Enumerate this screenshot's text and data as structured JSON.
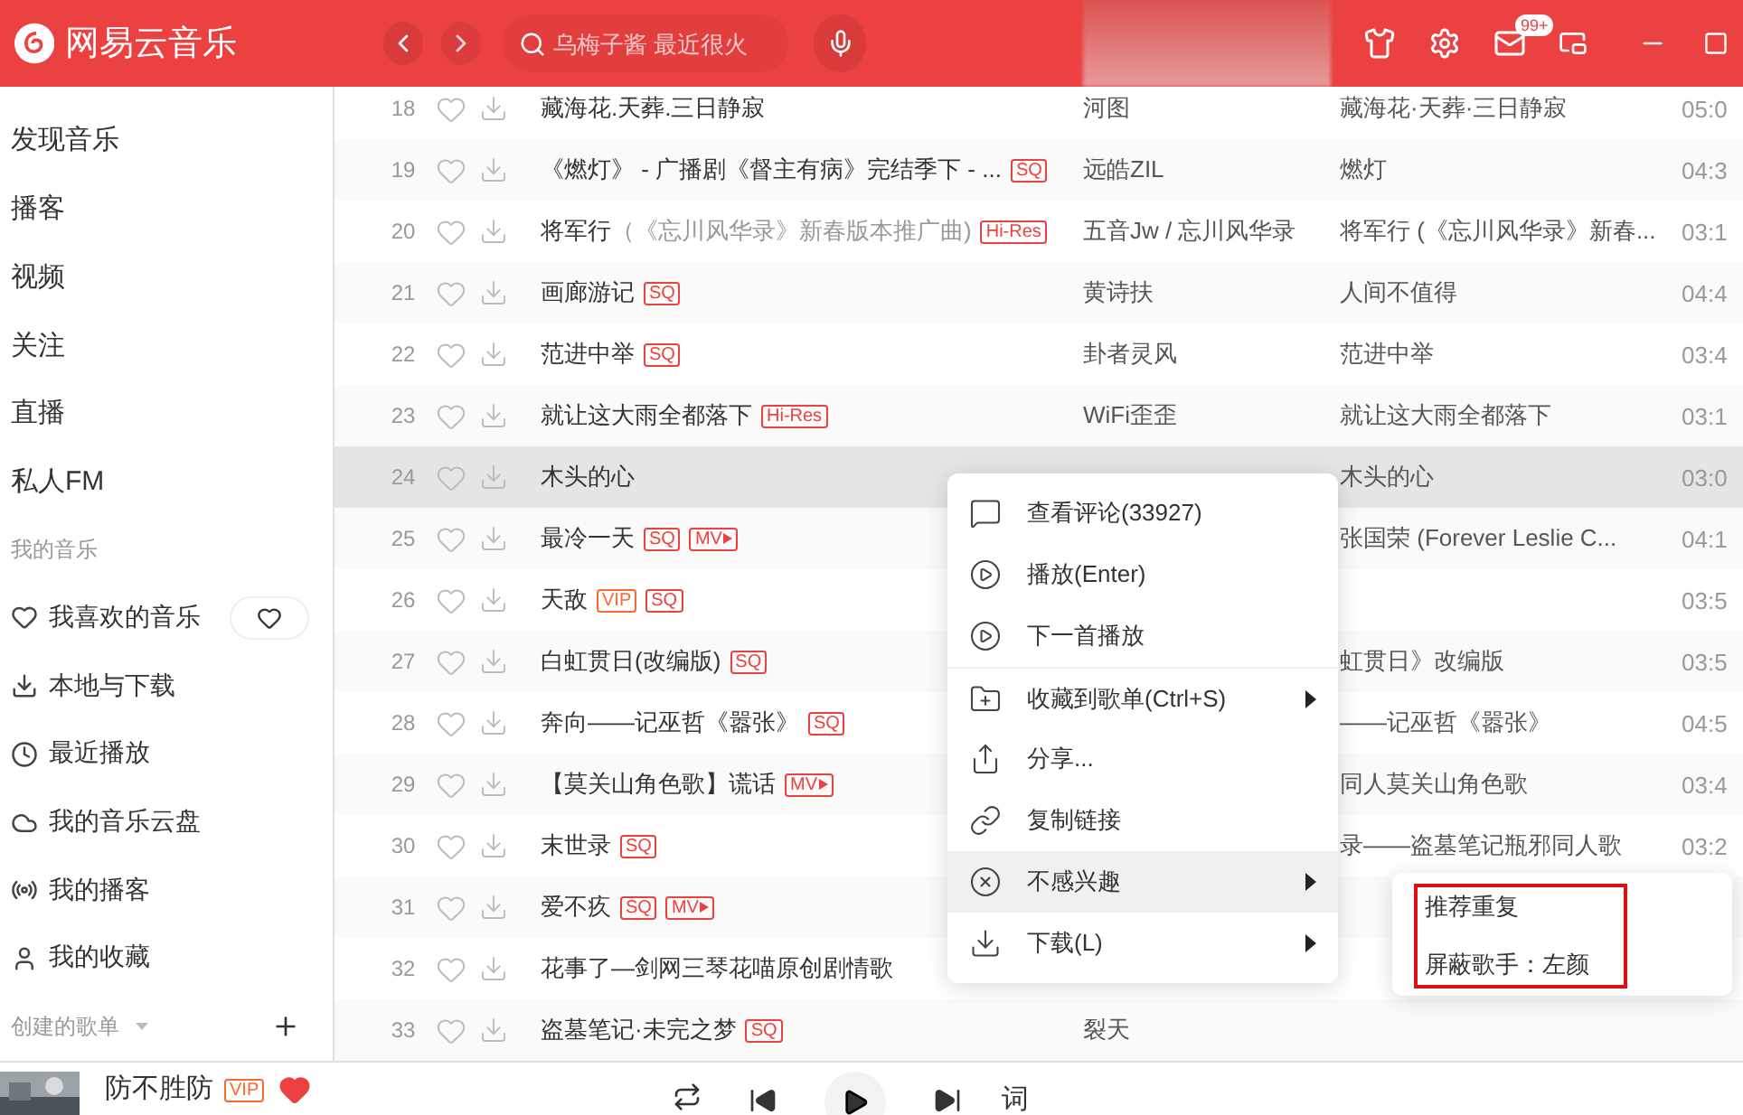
{
  "app": {
    "title": "网易云音乐"
  },
  "search": {
    "placeholder": "乌梅子酱 最近很火"
  },
  "mail": {
    "badge": "99+"
  },
  "sidebar": {
    "items": [
      {
        "label": "发现音乐"
      },
      {
        "label": "播客"
      },
      {
        "label": "视频"
      },
      {
        "label": "关注"
      },
      {
        "label": "直播"
      },
      {
        "label": "私人FM"
      }
    ],
    "my_music": {
      "title": "我的音乐",
      "items": [
        {
          "label": "我喜欢的音乐"
        },
        {
          "label": "本地与下载"
        },
        {
          "label": "最近播放"
        },
        {
          "label": "我的音乐云盘"
        },
        {
          "label": "我的播客"
        },
        {
          "label": "我的收藏"
        }
      ]
    },
    "playlists": {
      "title": "创建的歌单"
    }
  },
  "tracks": [
    {
      "number": "18",
      "title": "藏海花.天葬.三日静寂",
      "artist": "河图",
      "album": "藏海花·天葬·三日静寂",
      "duration": "05:0",
      "selected": false
    },
    {
      "number": "19",
      "title": "《燃灯》 - 广播剧《督主有病》完结季下 - ...",
      "badges": [
        {
          "kind": "sq",
          "text": "SQ"
        }
      ],
      "artist": "远皓ZIL",
      "album": "燃灯",
      "duration": "04:3",
      "selected": false
    },
    {
      "number": "20",
      "title": "将军行",
      "note": "（《忘川风华录》新春版本推广曲)",
      "badges": [
        {
          "kind": "hires",
          "text": "Hi-Res"
        }
      ],
      "artist": "五音Jw / 忘川风华录",
      "album": "将军行 (《忘川风华录》新春...",
      "duration": "03:1",
      "selected": false
    },
    {
      "number": "21",
      "title": "画廊游记",
      "badges": [
        {
          "kind": "sq",
          "text": "SQ"
        }
      ],
      "artist": "黄诗扶",
      "album": "人间不值得",
      "duration": "04:4",
      "selected": false
    },
    {
      "number": "22",
      "title": "范进中举",
      "badges": [
        {
          "kind": "sq",
          "text": "SQ"
        }
      ],
      "artist": "卦者灵风",
      "album": "范进中举",
      "duration": "03:4",
      "selected": false
    },
    {
      "number": "23",
      "title": "就让这大雨全都落下",
      "badges": [
        {
          "kind": "hires",
          "text": "Hi-Res"
        }
      ],
      "artist": "WiFi歪歪",
      "album": "就让这大雨全都落下",
      "duration": "03:1",
      "selected": false
    },
    {
      "number": "24",
      "title": "木头的心",
      "album": "木头的心",
      "duration": "03:0",
      "selected": true
    },
    {
      "number": "25",
      "title": "最冷一天",
      "badges": [
        {
          "kind": "sq",
          "text": "SQ"
        },
        {
          "kind": "mv",
          "text": "MV"
        }
      ],
      "album": "张国荣 (Forever Leslie C...",
      "duration": "04:1",
      "selected": false
    },
    {
      "number": "26",
      "title": "天敌",
      "badges": [
        {
          "kind": "vip",
          "text": "VIP"
        },
        {
          "kind": "sq",
          "text": "SQ"
        }
      ],
      "duration": "03:5",
      "selected": false
    },
    {
      "number": "27",
      "title": "白虹贯日(改编版)",
      "badges": [
        {
          "kind": "sq",
          "text": "SQ"
        }
      ],
      "album": "虹贯日》改编版",
      "duration": "03:5",
      "selected": false
    },
    {
      "number": "28",
      "title": "奔向——记巫哲《嚣张》",
      "badges": [
        {
          "kind": "sq",
          "text": "SQ"
        }
      ],
      "album": "——记巫哲《嚣张》",
      "duration": "04:5",
      "selected": false
    },
    {
      "number": "29",
      "title": "【莫关山角色歌】谎话",
      "badges": [
        {
          "kind": "mv",
          "text": "MV"
        }
      ],
      "album": "同人莫关山角色歌",
      "duration": "03:4",
      "selected": false
    },
    {
      "number": "30",
      "title": "末世录",
      "badges": [
        {
          "kind": "sq",
          "text": "SQ"
        }
      ],
      "album": "录——盗墓笔记瓶邪同人歌",
      "duration": "03:2",
      "selected": false
    },
    {
      "number": "31",
      "title": "爱不疚",
      "badges": [
        {
          "kind": "sq",
          "text": "SQ"
        },
        {
          "kind": "mv",
          "text": "MV"
        }
      ],
      "selected": false
    },
    {
      "number": "32",
      "title": "花事了—剑网三琴花喵原创剧情歌",
      "selected": false
    },
    {
      "number": "33",
      "title": "盗墓笔记·未完之梦",
      "badges": [
        {
          "kind": "sq",
          "text": "SQ"
        }
      ],
      "artist": "裂天",
      "selected": false
    }
  ],
  "context_menu": {
    "items": [
      {
        "label": "查看评论(33927)",
        "submenu": false,
        "divider_before": false,
        "selected": false
      },
      {
        "label": "播放(Enter)",
        "submenu": false,
        "divider_before": false,
        "selected": false
      },
      {
        "label": "下一首播放",
        "submenu": false,
        "divider_before": false,
        "selected": false
      },
      {
        "label": "收藏到歌单(Ctrl+S)",
        "submenu": true,
        "divider_before": true,
        "selected": false
      },
      {
        "label": "分享...",
        "submenu": false,
        "divider_before": false,
        "selected": false
      },
      {
        "label": "复制链接",
        "submenu": false,
        "divider_before": false,
        "selected": false
      },
      {
        "label": "不感兴趣",
        "submenu": true,
        "divider_before": false,
        "selected": true
      },
      {
        "label": "下载(L)",
        "submenu": true,
        "divider_before": false,
        "selected": false
      }
    ]
  },
  "submenu": {
    "highlighted": true,
    "items": [
      {
        "label": "推荐重复"
      },
      {
        "label": "屏蔽歌手：左颜"
      }
    ]
  },
  "player": {
    "title": "防不胜防",
    "badge": "VIP",
    "liked": true,
    "lyrics_button": "词"
  }
}
